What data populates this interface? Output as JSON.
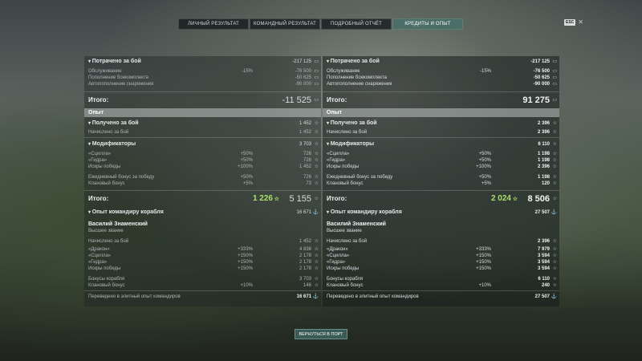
{
  "tabs": [
    "ЛИЧНЫЙ РЕЗУЛЬТАТ",
    "КОМАНДНЫЙ РЕЗУЛЬТАТ",
    "ПОДРОБНЫЙ ОТЧЁТ",
    "КРЕДИТЫ И ОПЫТ"
  ],
  "active_tab": 3,
  "esc_label": "ESC",
  "close_glyph": "✕",
  "back_button": "ВЕРНУТЬСЯ В ПОРТ",
  "left": {
    "spent_title": "Потрачено за бой",
    "spent_total": "-217 125",
    "service": "Обслуживание",
    "service_pct": "-15%",
    "service_val": "-76 500",
    "ammo": "Пополнение боекомплекта",
    "ammo_val": "-50 625",
    "consumables": "Автопополнение снаряжения",
    "consumables_val": "-90 000",
    "total_label": "Итого:",
    "total_val": "-11 525",
    "xp_bar": "Опыт",
    "earned_title": "Получено за бой",
    "earned_total": "1 452",
    "earned_row": "Начислено за бой",
    "earned_val": "1 452",
    "mods_title": "Модификаторы",
    "mods_total": "3 703",
    "m1": "«Сцилла»",
    "m1p": "+50%",
    "m1v": "726",
    "m2": "«Гидра»",
    "m2p": "+50%",
    "m2v": "726",
    "m3": "Искры победы",
    "m3p": "+100%",
    "m3v": "1 452",
    "m4": "Ежедневный бонус за победу",
    "m4p": "+50%",
    "m4v": "726",
    "m5": "Клановый бонус",
    "m5p": "+5%",
    "m5v": "73",
    "total2_label": "Итого:",
    "total2_green": "1 226",
    "total2_val": "5 155",
    "cmd_title": "Опыт командиру корабля",
    "cmd_total": "16 671",
    "cmd_name": "Василий Знаменский",
    "cmd_rank": "Высшее звание",
    "c1": "Начислено за бой",
    "c1v": "1 452",
    "c2": "«Дракон»",
    "c2p": "+333%",
    "c2v": "4 836",
    "c3": "«Сцилла»",
    "c3p": "+150%",
    "c3v": "2 178",
    "c4": "«Гидра»",
    "c4p": "+150%",
    "c4v": "2 178",
    "c5": "Искры победы",
    "c5p": "+150%",
    "c5v": "2 178",
    "c6": "Бонусы корабля",
    "c6v": "3 703",
    "c7": "Клановый бонус",
    "c7p": "+10%",
    "c7v": "146",
    "c8": "Переведено в элитный опыт командиров",
    "c8v": "16 671"
  },
  "right": {
    "spent_title": "Потрачено за бой",
    "spent_total": "-217 125",
    "service": "Обслуживание",
    "service_pct": "-15%",
    "service_val": "-76 500",
    "ammo": "Пополнение боекомплекта",
    "ammo_val": "-50 625",
    "consumables": "Автопополнение снаряжения",
    "consumables_val": "-90 000",
    "total_label": "Итого:",
    "total_val": "91 275",
    "xp_bar": "Опыт",
    "earned_title": "Получено за бой",
    "earned_total": "2 396",
    "earned_row": "Начислено за бой",
    "earned_val": "2 396",
    "mods_title": "Модификаторы",
    "mods_total": "6 110",
    "m1": "«Сцилла»",
    "m1p": "+50%",
    "m1v": "1 198",
    "m2": "«Гидра»",
    "m2p": "+50%",
    "m2v": "1 198",
    "m3": "Искры победы",
    "m3p": "+100%",
    "m3v": "2 396",
    "m4": "Ежедневный бонус за победу",
    "m4p": "+50%",
    "m4v": "1 198",
    "m5": "Клановый бонус",
    "m5p": "+5%",
    "m5v": "120",
    "total2_label": "Итого:",
    "total2_green": "2 024",
    "total2_val": "8 506",
    "cmd_title": "Опыт командиру корабля",
    "cmd_total": "27 507",
    "cmd_name": "Василий Знаменский",
    "cmd_rank": "Высшее звание",
    "c1": "Начислено за бой",
    "c1v": "2 396",
    "c2": "«Дракон»",
    "c2p": "+333%",
    "c2v": "7 979",
    "c3": "«Сцилла»",
    "c3p": "+150%",
    "c3v": "3 594",
    "c4": "«Гидра»",
    "c4p": "+150%",
    "c4v": "3 594",
    "c5": "Искры победы",
    "c5p": "+150%",
    "c5v": "3 594",
    "c6": "Бонусы корабля",
    "c6v": "6 110",
    "c7": "Клановый бонус",
    "c7p": "+10%",
    "c7v": "240",
    "c8": "Переведено в элитный опыт командиров",
    "c8v": "27 507"
  }
}
